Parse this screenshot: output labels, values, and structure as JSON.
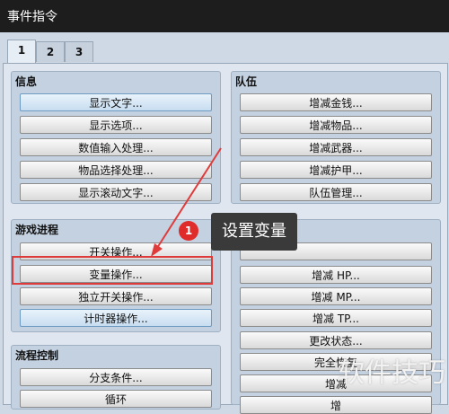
{
  "window": {
    "title": "事件指令"
  },
  "tabs": [
    "1",
    "2",
    "3"
  ],
  "groups": {
    "info": {
      "title": "信息",
      "buttons": [
        "显示文字...",
        "显示选项...",
        "数值输入处理...",
        "物品选择处理...",
        "显示滚动文字..."
      ]
    },
    "party": {
      "title": "队伍",
      "buttons": [
        "增减金钱...",
        "增减物品...",
        "增减武器...",
        "增减护甲...",
        "队伍管理..."
      ]
    },
    "progress": {
      "title": "游戏进程",
      "buttons": [
        "开关操作...",
        "变量操作...",
        "独立开关操作...",
        "计时器操作..."
      ]
    },
    "actor": {
      "buttons": [
        "增减 HP...",
        "增减 MP...",
        "增减 TP...",
        "更改状态...",
        "完全恢复",
        "增减",
        "增",
        "增"
      ]
    },
    "flow": {
      "title": "流程控制",
      "buttons": [
        "分支条件...",
        "循环"
      ]
    }
  },
  "annotation": {
    "number": "1",
    "text": "设置变量"
  },
  "watermark": "软件技巧",
  "colors": {
    "highlight_box": "#e03b3b",
    "callout_bg": "#3a3a3a",
    "badge": "#e02b2b"
  }
}
